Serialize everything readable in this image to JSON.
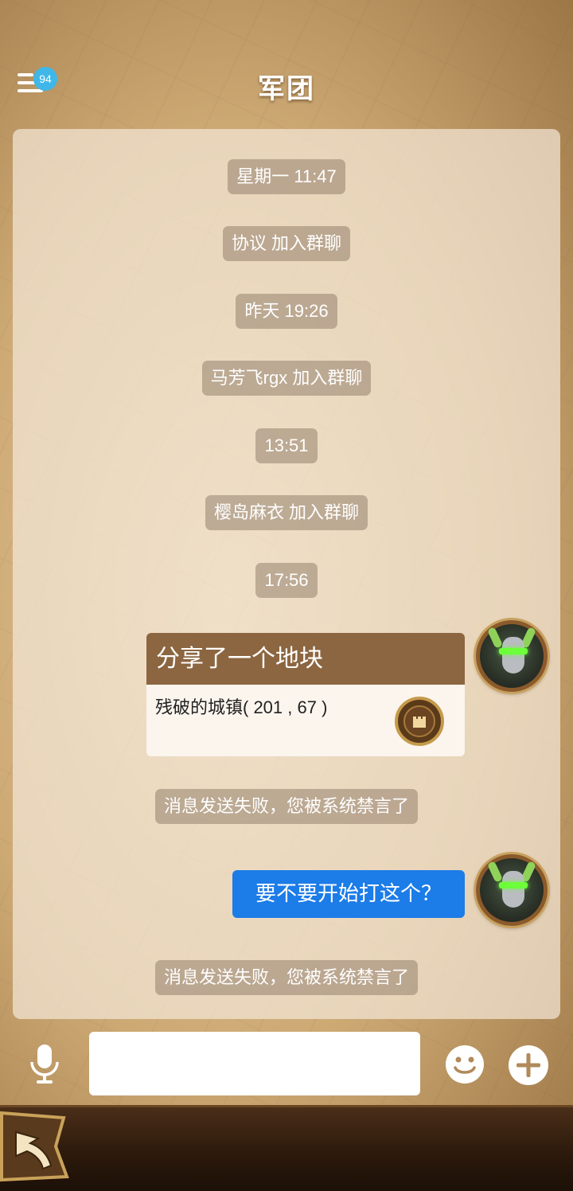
{
  "header": {
    "title": "军团",
    "badge_count": "94"
  },
  "messages": [
    {
      "type": "system",
      "text": "星期一 11:47"
    },
    {
      "type": "system",
      "text": "协议 加入群聊"
    },
    {
      "type": "system",
      "text": "昨天 19:26"
    },
    {
      "type": "system",
      "text": "马芳飞rgx 加入群聊"
    },
    {
      "type": "system",
      "text": "13:51"
    },
    {
      "type": "system",
      "text": "樱岛麻衣 加入群聊"
    },
    {
      "type": "system",
      "text": "17:56"
    },
    {
      "type": "share",
      "title": "分享了一个地块",
      "text": "残破的城镇( 201 , 67 )"
    },
    {
      "type": "system",
      "text": "消息发送失败，您被系统禁言了"
    },
    {
      "type": "outgoing",
      "text": "要不要开始打这个？"
    },
    {
      "type": "system",
      "text": "消息发送失败，您被系统禁言了"
    }
  ],
  "composer": {
    "value": "",
    "placeholder": ""
  },
  "icons": {
    "menu": "menu-icon",
    "mic": "microphone-icon",
    "emoji": "smiley-icon",
    "add": "plus-icon",
    "back": "back-arrow-icon",
    "castle": "castle-icon"
  },
  "colors": {
    "badge": "#3fb7e8",
    "outgoing_bubble": "#1c7ce8",
    "share_header": "#8c6640"
  }
}
